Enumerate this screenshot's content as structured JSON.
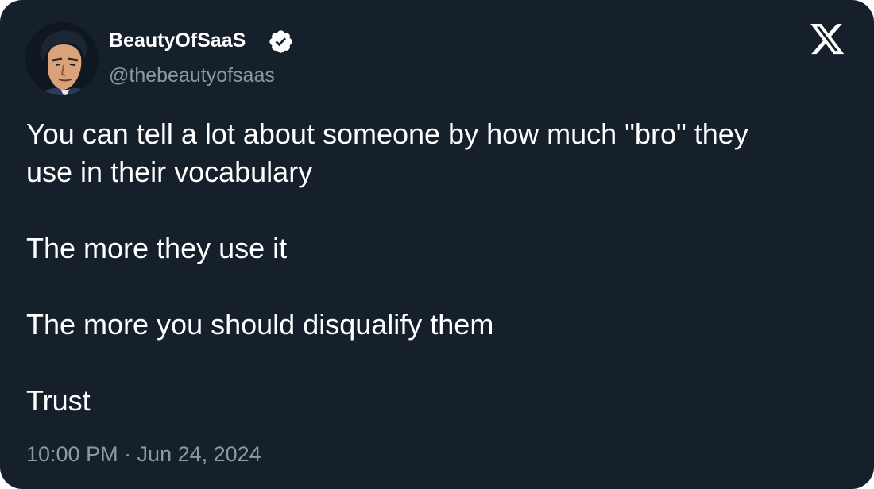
{
  "author": {
    "display_name": "BeautyOfSaaS",
    "handle": "@thebeautyofsaas",
    "verified": true,
    "avatar_icon": "avatar-comic-portrait"
  },
  "brand_icon": "x-logo-icon",
  "tweet": {
    "lines": [
      "You can tell a lot about someone by how much \"bro\" they",
      "use in their vocabulary",
      "The more they use it",
      "The more you should disqualify them",
      "Trust"
    ],
    "timestamp": "10:00 PM · Jun 24, 2024"
  },
  "colors": {
    "background": "#15202b",
    "text": "#ffffff",
    "muted": "#8b98a5"
  }
}
